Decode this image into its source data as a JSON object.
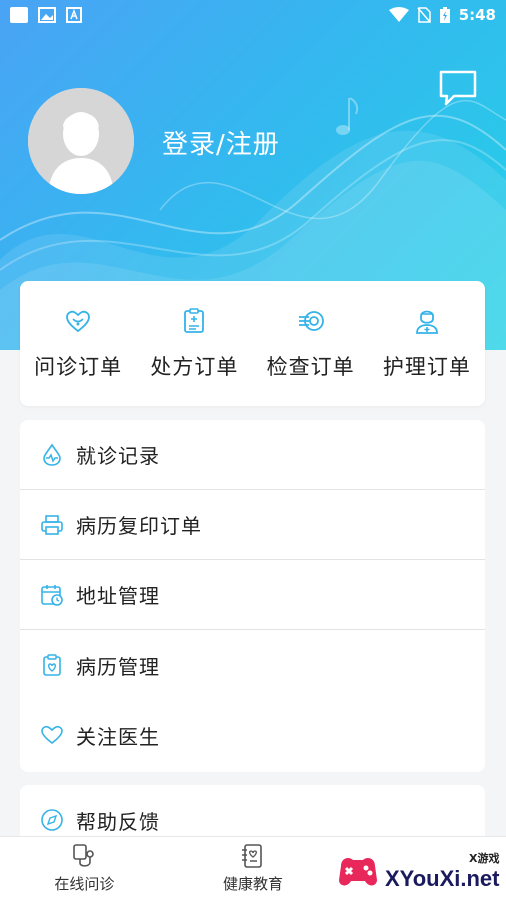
{
  "status_bar": {
    "time": "5:48"
  },
  "header": {
    "login_label": "登录/注册"
  },
  "orders": [
    {
      "label": "问诊订单",
      "icon": "consultation-icon"
    },
    {
      "label": "处方订单",
      "icon": "prescription-icon"
    },
    {
      "label": "检查订单",
      "icon": "examination-icon"
    },
    {
      "label": "护理订单",
      "icon": "nursing-icon"
    }
  ],
  "menu": [
    {
      "label": "就诊记录",
      "icon": "heartbeat-drop-icon"
    },
    {
      "label": "病历复印订单",
      "icon": "printer-icon"
    },
    {
      "label": "地址管理",
      "icon": "calendar-clock-icon"
    },
    {
      "label": "病历管理",
      "icon": "clipboard-heart-icon"
    },
    {
      "label": "关注医生",
      "icon": "heart-icon"
    }
  ],
  "menu2": [
    {
      "label": "帮助反馈",
      "icon": "compass-icon"
    }
  ],
  "tabbar": [
    {
      "label": "在线问诊",
      "icon": "stethoscope-icon"
    },
    {
      "label": "健康教育",
      "icon": "book-icon"
    }
  ],
  "watermark": {
    "small": "X游戏",
    "big": "XYouXi.net"
  },
  "colors": {
    "accent": "#35b3e8",
    "header_start": "#4aa3f5",
    "header_end": "#24d2e6"
  }
}
